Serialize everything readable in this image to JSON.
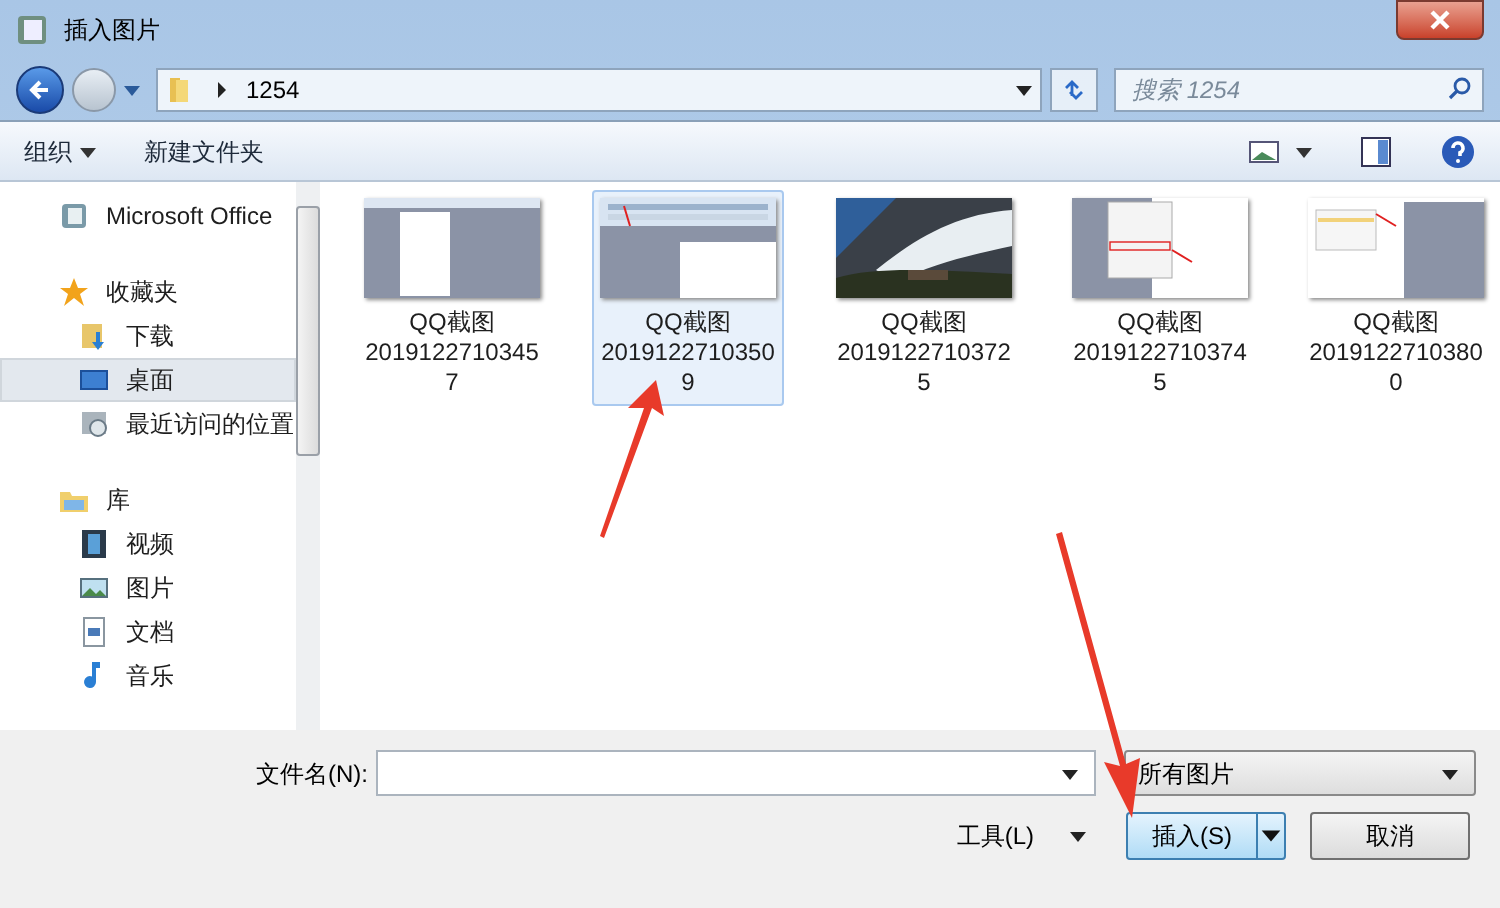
{
  "window": {
    "title": "插入图片"
  },
  "address": {
    "path": "1254",
    "search_placeholder": "搜索 1254"
  },
  "toolbar": {
    "organize": "组织",
    "new_folder": "新建文件夹"
  },
  "sidebar": {
    "items": [
      {
        "label": "Microsoft Office",
        "kind": "office",
        "selected": false
      },
      {
        "label": "收藏夹",
        "kind": "star",
        "selected": false,
        "children": [
          {
            "label": "下载",
            "kind": "download",
            "selected": false
          },
          {
            "label": "桌面",
            "kind": "desktop",
            "selected": true
          },
          {
            "label": "最近访问的位置",
            "kind": "recent",
            "selected": false
          }
        ]
      },
      {
        "label": "库",
        "kind": "library",
        "selected": false,
        "children": [
          {
            "label": "视频",
            "kind": "video",
            "selected": false
          },
          {
            "label": "图片",
            "kind": "pictures",
            "selected": false
          },
          {
            "label": "文档",
            "kind": "document",
            "selected": false
          },
          {
            "label": "音乐",
            "kind": "music",
            "selected": false
          }
        ]
      }
    ]
  },
  "files": [
    {
      "lines": [
        "QQ截图",
        "2019122710345",
        "7"
      ],
      "kind": "page",
      "selected": false
    },
    {
      "lines": [
        "QQ截图",
        "2019122710350",
        "9"
      ],
      "kind": "toolbar",
      "selected": true
    },
    {
      "lines": [
        "QQ截图",
        "2019122710372",
        "5"
      ],
      "kind": "picture",
      "selected": false
    },
    {
      "lines": [
        "QQ截图",
        "2019122710374",
        "5"
      ],
      "kind": "menu",
      "selected": false
    },
    {
      "lines": [
        "QQ截图",
        "2019122710380",
        "0"
      ],
      "kind": "popup",
      "selected": false
    }
  ],
  "footer": {
    "filename_label": "文件名(N):",
    "filter": "所有图片",
    "tools": "工具(L)",
    "insert": "插入(S)",
    "cancel": "取消"
  }
}
